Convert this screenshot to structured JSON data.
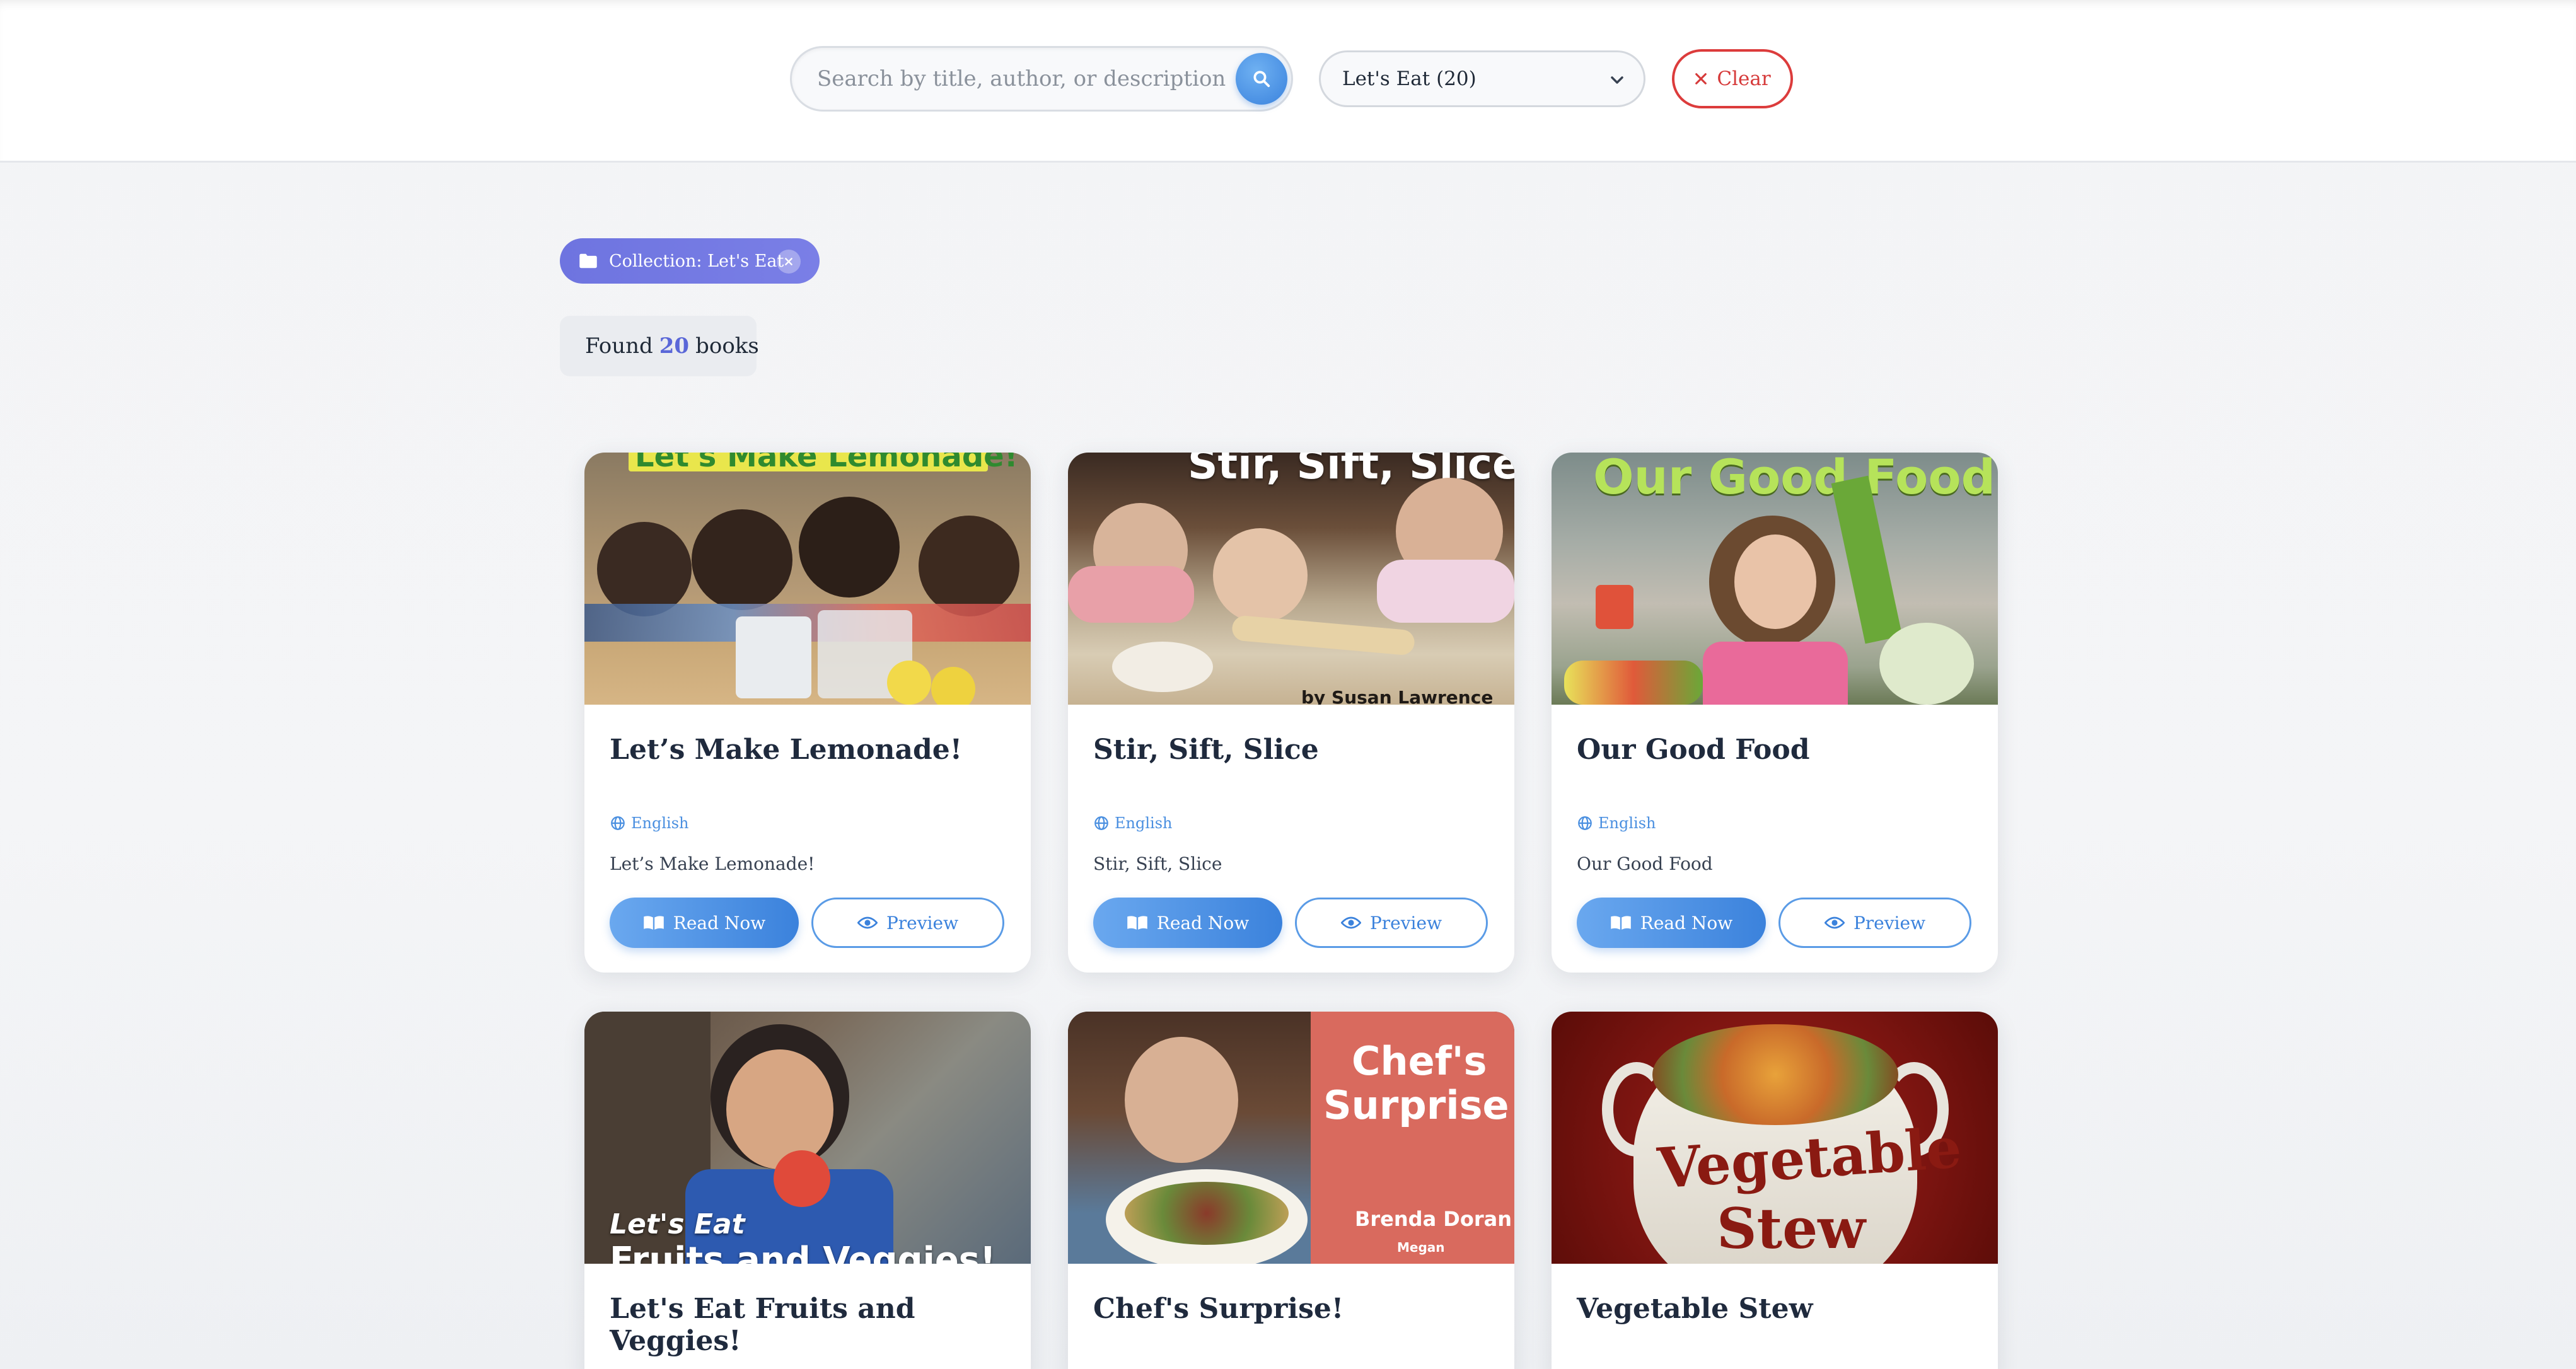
{
  "search": {
    "placeholder": "Search by title, author, or description...",
    "value": ""
  },
  "collection_select": {
    "selected": "Let's Eat (20)"
  },
  "clear_button": {
    "label": "Clear"
  },
  "filter_chip": {
    "label": "Collection: Let's Eat"
  },
  "results": {
    "prefix": "Found",
    "count": "20",
    "suffix": "books"
  },
  "books": [
    {
      "cover_text": "Let's Make Lemonade!",
      "title": "Let’s Make Lemonade!",
      "language": "English",
      "description": "Let’s Make Lemonade!",
      "read_label": "Read Now",
      "preview_label": "Preview"
    },
    {
      "cover_text": "Stir, Sift, Slice",
      "cover_credit": "by Susan Lawrence",
      "title": "Stir, Sift, Slice",
      "language": "English",
      "description": "Stir, Sift, Slice",
      "read_label": "Read Now",
      "preview_label": "Preview"
    },
    {
      "cover_text": "Our Good Food",
      "title": "Our Good Food",
      "language": "English",
      "description": "Our Good Food",
      "read_label": "Read Now",
      "preview_label": "Preview"
    },
    {
      "cover_text_line1": "Let's Eat",
      "cover_text_line2": "Fruits and Veggies!",
      "title": "Let's Eat Fruits and Veggies!"
    },
    {
      "cover_text_line1": "Chef's",
      "cover_text_line2": "Surprise!",
      "cover_author": "Brenda Doran",
      "cover_illustrator": "Megan",
      "title": "Chef's Surprise!"
    },
    {
      "cover_text_line1": "Vegetable",
      "cover_text_line2": "Stew",
      "title": "Vegetable Stew"
    }
  ],
  "colors": {
    "accent_blue": "#3b82dc",
    "chip_purple": "#6e74e0",
    "clear_red": "#dc3c3c",
    "count_blue": "#5a67d8"
  }
}
